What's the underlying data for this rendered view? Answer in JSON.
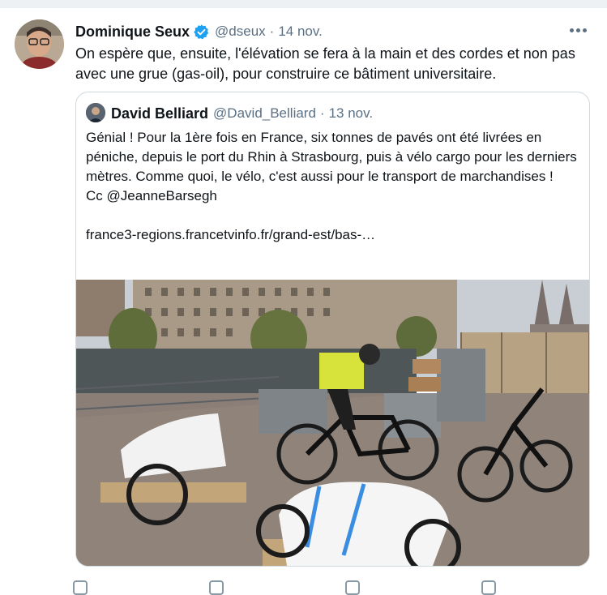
{
  "tweet": {
    "author_name": "Dominique Seux",
    "handle": "@dseux",
    "separator": "·",
    "date": "14 nov.",
    "text": "On espère que, ensuite, l'élévation se fera à la main et des cordes et non pas avec une grue (gas-oil), pour construire ce bâtiment universitaire."
  },
  "quoted": {
    "author_name": "David Belliard",
    "handle": "@David_Belliard",
    "separator": "·",
    "date": "13 nov.",
    "text": "Génial ! Pour la 1ère fois en France, six tonnes de pavés ont été livrées en péniche, depuis le port du Rhin à Strasbourg, puis à vélo cargo pour les derniers mètres. Comme quoi, le vélo, c'est aussi pour le transport de marchandises !\nCc @JeanneBarsegh\n\nfrance3-regions.francetvinfo.fr/grand-est/bas-…"
  },
  "colors": {
    "verified": "#1da1f2",
    "secondary_text": "#5b7083",
    "border": "#cfd9de"
  },
  "icons": {
    "verified": "verified-badge-icon",
    "more": "more-options-icon"
  }
}
